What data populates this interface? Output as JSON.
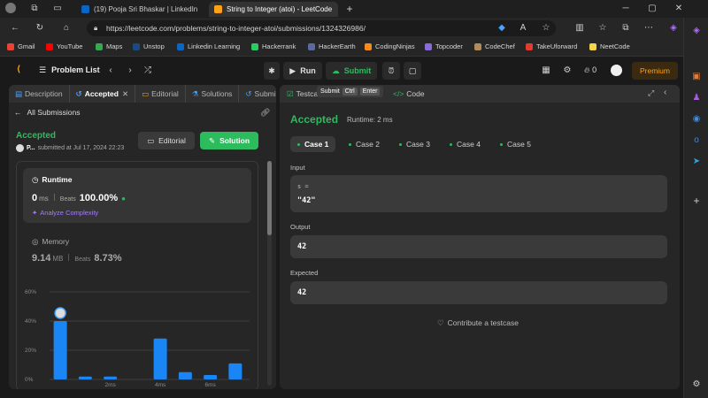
{
  "browser": {
    "tabs": [
      {
        "title": "(19) Pooja Sri Bhaskar | LinkedIn",
        "favicon_color": "#0a66c2",
        "favicon_text": "in"
      },
      {
        "title": "String to Integer (atoi) - LeetCode",
        "favicon_color": "#ffa116",
        "favicon_text": ""
      }
    ],
    "url": "https://leetcode.com/problems/string-to-integer-atoi/submissions/1324326986/",
    "bookmarks": [
      {
        "label": "Gmail",
        "color": "#ea4335"
      },
      {
        "label": "YouTube",
        "color": "#ff0000"
      },
      {
        "label": "Maps",
        "color": "#34a853"
      },
      {
        "label": "Unstop",
        "color": "#1c4980"
      },
      {
        "label": "Linkedin Learning",
        "color": "#0a66c2"
      },
      {
        "label": "Hackerrank",
        "color": "#2ec866"
      },
      {
        "label": "HackerEarth",
        "color": "#323754"
      },
      {
        "label": "CodingNinjas",
        "color": "#f78b1f"
      },
      {
        "label": "Topcoder",
        "color": "#8a6cd8"
      },
      {
        "label": "CodeChef",
        "color": "#b08b5c"
      },
      {
        "label": "TakeUforward",
        "color": "#e33b2e"
      },
      {
        "label": "NeetCode",
        "color": "#f5d547"
      }
    ]
  },
  "header": {
    "problem_list": "Problem List",
    "run": "Run",
    "submit": "Submit",
    "streak": "0",
    "premium": "Premium",
    "tooltip": {
      "label": "Submit",
      "key1": "Ctrl",
      "key2": "Enter"
    }
  },
  "left": {
    "tabs": [
      "Description",
      "Accepted",
      "Editorial",
      "Solutions",
      "Submissions"
    ],
    "back": "All Submissions",
    "status": "Accepted",
    "user": "P...",
    "submitted": "submitted at Jul 17, 2024 22:23",
    "editorial_btn": "Editorial",
    "solution_btn": "Solution",
    "runtime": {
      "title": "Runtime",
      "value": "0",
      "unit": "ms",
      "beats_label": "Beats",
      "beats": "100.00%",
      "analyze": "Analyze Complexity"
    },
    "memory": {
      "title": "Memory",
      "value": "9.14",
      "unit": "MB",
      "beats_label": "Beats",
      "beats": "8.73%"
    }
  },
  "chart_data": {
    "type": "bar",
    "yticks": [
      "60%",
      "40%",
      "20%",
      "0%"
    ],
    "xticks": [
      "2ms",
      "4ms",
      "6ms"
    ],
    "ylim": [
      0,
      60
    ],
    "values": [
      40,
      2,
      2,
      0,
      28,
      5,
      3,
      11
    ],
    "highlight_index": 0
  },
  "right": {
    "tab_testcase": "Testcase",
    "tab_code": "Code",
    "status": "Accepted",
    "runtime": "Runtime: 2 ms",
    "cases": [
      "Case 1",
      "Case 2",
      "Case 3",
      "Case 4",
      "Case 5"
    ],
    "input_label": "Input",
    "input_var": "s =",
    "input_value": "\"42\"",
    "output_label": "Output",
    "output_value": "42",
    "expected_label": "Expected",
    "expected_value": "42",
    "contribute": "Contribute a testcase"
  }
}
